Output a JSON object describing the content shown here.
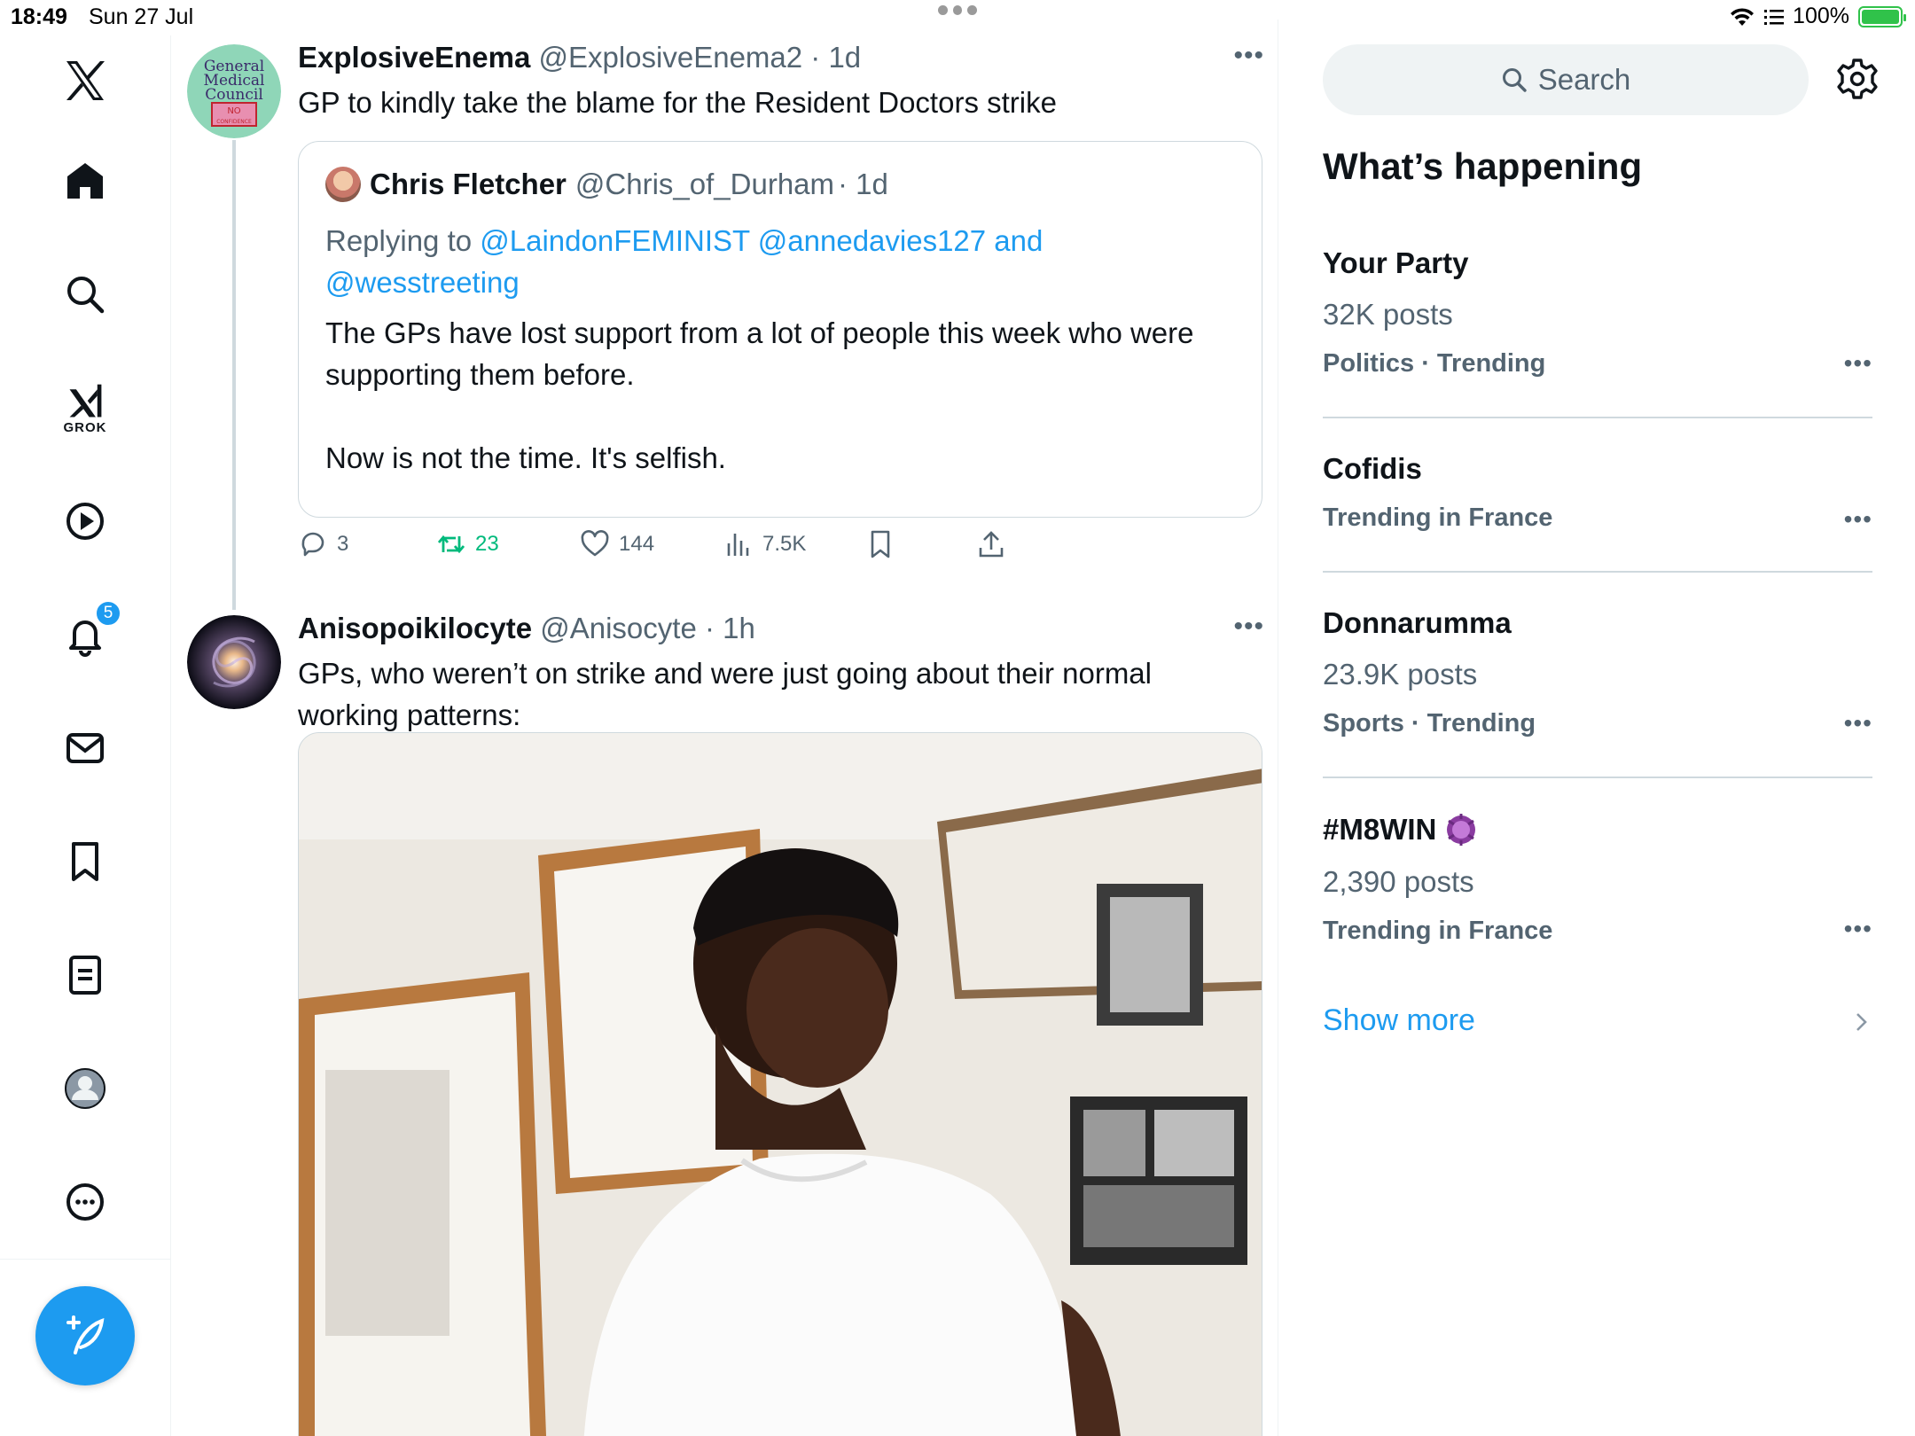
{
  "status_bar": {
    "time": "18:49",
    "date": "Sun 27 Jul",
    "battery": "100%"
  },
  "nav": {
    "grok_label": "GROK",
    "notifications_badge": "5",
    "items": [
      "x-logo",
      "home-icon",
      "search-icon",
      "grok-icon",
      "video-icon",
      "bell-icon",
      "mail-icon",
      "bookmark-icon",
      "lists-icon",
      "profile-icon",
      "more-icon"
    ]
  },
  "tweets": [
    {
      "name": "ExplosiveEnema",
      "handle": "@ExplosiveEnema2",
      "time": "· 1d",
      "text": "GP to kindly take the blame for the Resident Doctors strike",
      "avatar_lines": [
        "General",
        "Medical",
        "Council",
        "NO",
        "CONFIDENCE"
      ],
      "quote": {
        "name": "Chris Fletcher",
        "handle": "@Chris_of_Durham",
        "time": "· 1d",
        "replying_prefix": "Replying to ",
        "replying_links": "@LaindonFEMINIST @annedavies127 and @wesstreeting",
        "body_1": "The GPs have lost support from a lot of people this week who were supporting them before.",
        "body_2": "Now is not the time. It's selfish."
      },
      "actions": {
        "replies": "3",
        "reposts": "23",
        "likes": "144",
        "views": "7.5K"
      }
    },
    {
      "name": "Anisopoikilocyte",
      "handle": "@Anisocyte",
      "time": "· 1h",
      "text": "GPs, who weren’t on strike and were just going about their normal working patterns:"
    }
  ],
  "sidebar": {
    "search_placeholder": "Search",
    "title": "What’s happening",
    "trends": [
      {
        "name": "Your Party",
        "posts": "32K posts",
        "context": "Politics · Trending"
      },
      {
        "name": "Cofidis",
        "posts": "",
        "context": "Trending in France"
      },
      {
        "name": "Donnarumma",
        "posts": "23.9K posts",
        "context": "Sports · Trending"
      },
      {
        "name": "#M8WIN",
        "posts": "2,390 posts",
        "context": "Trending in France"
      }
    ],
    "show_more": "Show more"
  },
  "colors": {
    "accent": "#1d9bf0",
    "repost": "#00ba7c",
    "text": "#0f1419",
    "secondary": "#536471",
    "border": "#cfd9de"
  }
}
